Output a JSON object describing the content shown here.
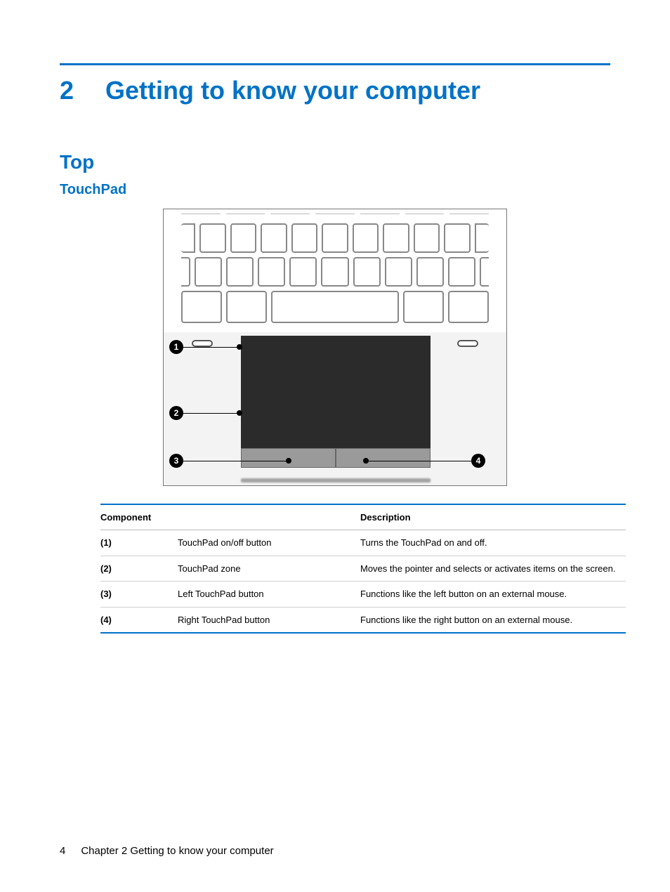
{
  "chapter": {
    "number": "2",
    "title": "Getting to know your computer"
  },
  "section": "Top",
  "subsection": "TouchPad",
  "figure": {
    "callouts": [
      "1",
      "2",
      "3",
      "4"
    ]
  },
  "table": {
    "headers": {
      "component": "Component",
      "description": "Description"
    },
    "rows": [
      {
        "idx": "(1)",
        "component": "TouchPad on/off button",
        "description": "Turns the TouchPad on and off."
      },
      {
        "idx": "(2)",
        "component": "TouchPad zone",
        "description": "Moves the pointer and selects or activates items on the screen."
      },
      {
        "idx": "(3)",
        "component": "Left TouchPad button",
        "description": "Functions like the left button on an external mouse."
      },
      {
        "idx": "(4)",
        "component": "Right TouchPad button",
        "description": "Functions like the right button on an external mouse."
      }
    ]
  },
  "footer": {
    "page": "4",
    "text": "Chapter 2   Getting to know your computer"
  }
}
